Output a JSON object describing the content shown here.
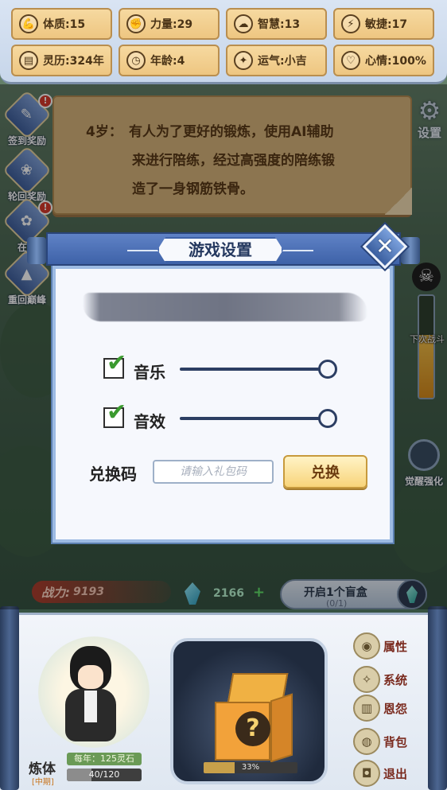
{
  "stats": [
    {
      "label": "体质:15",
      "icon": "strength-arm-icon"
    },
    {
      "label": "力量:29",
      "icon": "fist-icon"
    },
    {
      "label": "智慧:13",
      "icon": "brain-icon"
    },
    {
      "label": "敏捷:17",
      "icon": "lightning-icon"
    },
    {
      "label": "灵历:324年",
      "icon": "scroll-icon"
    },
    {
      "label": "年龄:4",
      "icon": "clock-icon"
    },
    {
      "label": "运气:小吉",
      "icon": "sparkle-icon"
    },
    {
      "label": "心情:100%",
      "icon": "heart-icon"
    }
  ],
  "story": {
    "age": "4岁：",
    "line1": "有人为了更好的锻炼，使用AI辅助",
    "line2": "来进行陪练，经过高强度的陪练锻",
    "line3": "造了一身钢筋铁骨。"
  },
  "side_buttons": [
    {
      "label": "签到奖励",
      "alert": "!"
    },
    {
      "label": "轮回奖励"
    },
    {
      "label": "在线",
      "alert": "!"
    },
    {
      "label": "重回巅峰"
    }
  ],
  "settings_label": "设置",
  "next_battle_label": "下次战斗",
  "next_battle_progress": 0.62,
  "awaken_label": "觉醒强化",
  "dialog": {
    "title": "游戏设置",
    "close": "✕",
    "music": {
      "label": "音乐",
      "checked": true,
      "volume": 1.0
    },
    "sfx": {
      "label": "音效",
      "checked": true,
      "volume": 1.0
    },
    "redeem": {
      "label": "兑换码",
      "placeholder": "请输入礼包码",
      "value": "",
      "button": "兑换"
    }
  },
  "power": {
    "label": "战力:",
    "value": "9193"
  },
  "spirit_stones": {
    "value": "2166",
    "add": "+"
  },
  "blindbox": {
    "title": "开启1个盲盒",
    "count": "(0/1)",
    "progress_text": "33%",
    "progress": 0.33
  },
  "hero": {
    "level": "炼体",
    "stage": "[中期]",
    "yearly": "每年：125灵石",
    "xp_text": "40/120",
    "xp": 0.333
  },
  "menu": [
    {
      "label": "属性",
      "icon": "attribute-icon"
    },
    {
      "label": "系统",
      "icon": "system-icon"
    },
    {
      "label": "恩怨",
      "icon": "grudge-icon"
    },
    {
      "label": "背包",
      "icon": "bag-icon"
    },
    {
      "label": "退出",
      "icon": "exit-icon"
    }
  ],
  "colors": {
    "accent_blue": "#3e62a8",
    "parchment": "#d7b47c",
    "check_green": "#3a9a2e",
    "redeem_gold": "#f8d47a"
  }
}
